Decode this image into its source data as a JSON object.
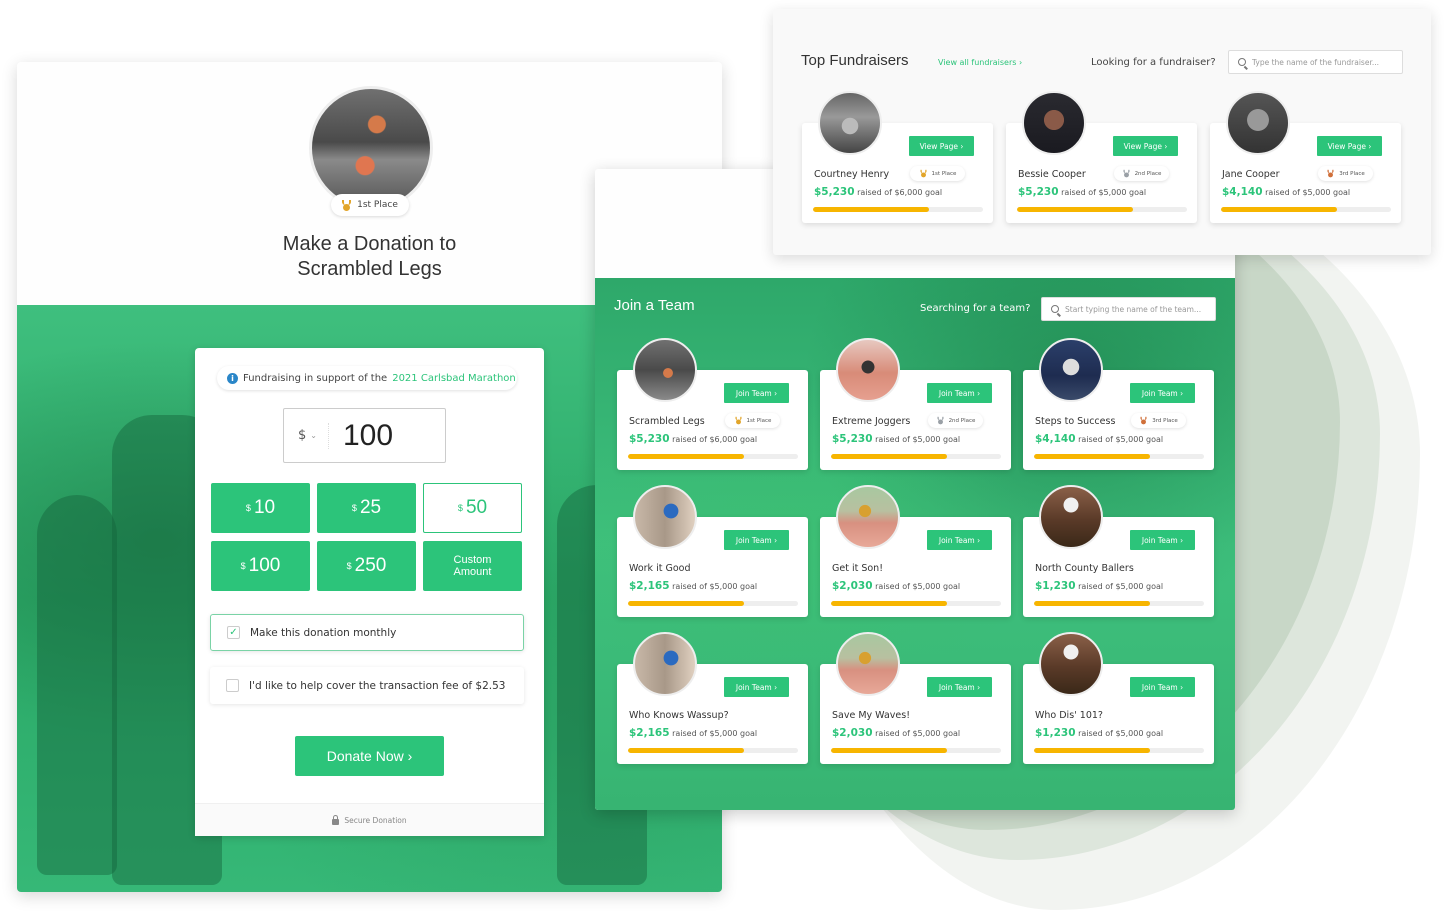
{
  "colors": {
    "brand_green": "#2cc47a",
    "progress_yellow": "#f7b500",
    "info_blue": "#2a86c8"
  },
  "donation": {
    "place_badge": "1st Place",
    "title_line1": "Make a Donation to",
    "title_line2": "Scrambled Legs",
    "support_prefix": "Fundraising in support of the",
    "support_link": "2021 Carlsbad Marathon",
    "currency": "$",
    "amount": "100",
    "preset_amounts": [
      {
        "symbol": "$",
        "value": "10",
        "selected": false
      },
      {
        "symbol": "$",
        "value": "25",
        "selected": false
      },
      {
        "symbol": "$",
        "value": "50",
        "selected": true
      },
      {
        "symbol": "$",
        "value": "100",
        "selected": false
      },
      {
        "symbol": "$",
        "value": "250",
        "selected": false
      }
    ],
    "custom_line1": "Custom",
    "custom_line2": "Amount",
    "monthly_label": "Make this donation monthly",
    "monthly_checked": true,
    "fee_label": "I'd like to help cover the transaction fee of $2.53",
    "fee_checked": false,
    "donate_button": "Donate Now ›",
    "secure_label": "Secure Donation"
  },
  "teams": {
    "title": "Join a Team",
    "search_label": "Searching for a team?",
    "search_placeholder": "Start typing the name of the team...",
    "join_label": "Join Team ›",
    "items": [
      {
        "name": "Scrambled Legs",
        "raised": "$5,230",
        "goal_text": "raised of $6,000 goal",
        "place": "1st Place",
        "progress": 0.68
      },
      {
        "name": "Extreme Joggers",
        "raised": "$5,230",
        "goal_text": "raised of $5,000 goal",
        "place": "2nd Place",
        "progress": 0.68
      },
      {
        "name": "Steps to Success",
        "raised": "$4,140",
        "goal_text": "raised of $5,000 goal",
        "place": "3rd Place",
        "progress": 0.68
      },
      {
        "name": "Work it Good",
        "raised": "$2,165",
        "goal_text": "raised of $5,000 goal",
        "place": "",
        "progress": 0.68
      },
      {
        "name": "Get it Son!",
        "raised": "$2,030",
        "goal_text": "raised of $5,000 goal",
        "place": "",
        "progress": 0.68
      },
      {
        "name": "North County Ballers",
        "raised": "$1,230",
        "goal_text": "raised of $5,000 goal",
        "place": "",
        "progress": 0.68
      },
      {
        "name": "Who Knows Wassup?",
        "raised": "$2,165",
        "goal_text": "raised of $5,000 goal",
        "place": "",
        "progress": 0.68
      },
      {
        "name": "Save My Waves!",
        "raised": "$2,030",
        "goal_text": "raised of $5,000 goal",
        "place": "",
        "progress": 0.68
      },
      {
        "name": "Who Dis' 101?",
        "raised": "$1,230",
        "goal_text": "raised of $5,000 goal",
        "place": "",
        "progress": 0.68
      }
    ]
  },
  "fundraisers": {
    "title": "Top Fundraisers",
    "view_all": "View all fundraisers ›",
    "search_label": "Looking for a fundraiser?",
    "search_placeholder": "Type the name of the fundraiser...",
    "view_label": "View Page ›",
    "items": [
      {
        "name": "Courtney Henry",
        "raised": "$5,230",
        "goal_text": "raised of $6,000 goal",
        "place": "1st Place",
        "progress": 0.68
      },
      {
        "name": "Bessie Cooper",
        "raised": "$5,230",
        "goal_text": "raised of $5,000 goal",
        "place": "2nd Place",
        "progress": 0.68
      },
      {
        "name": "Jane Cooper",
        "raised": "$4,140",
        "goal_text": "raised of $5,000 goal",
        "place": "3rd Place",
        "progress": 0.68
      }
    ]
  }
}
